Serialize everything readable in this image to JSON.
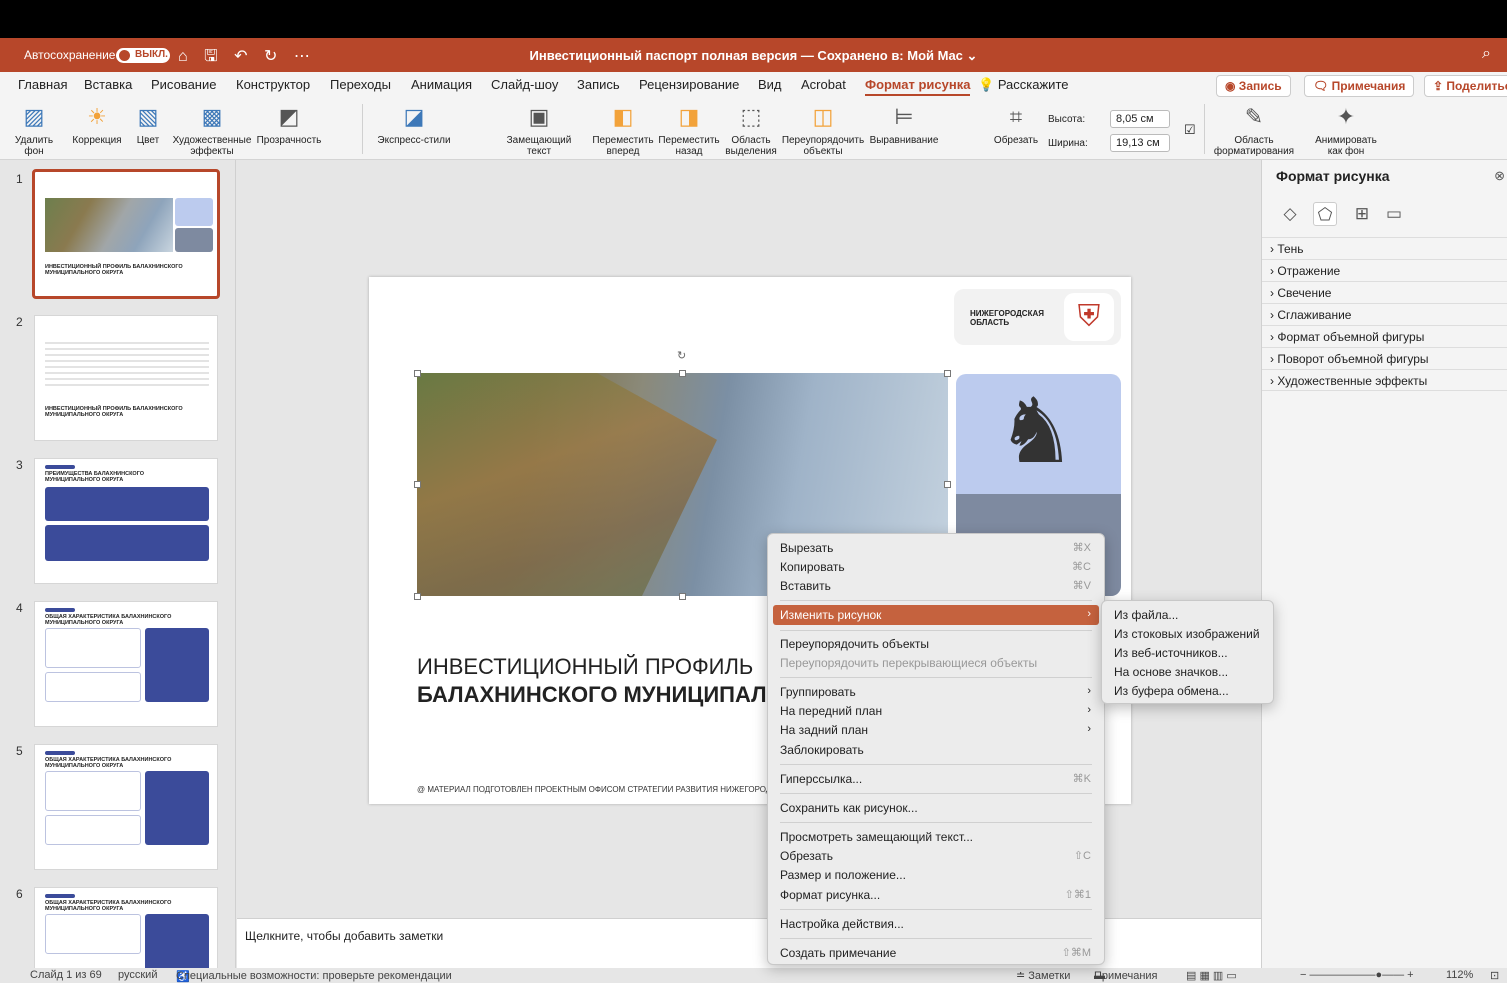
{
  "app": {
    "autosave_label": "Автосохранение",
    "autosave_state": "ВЫКЛ.",
    "doc_title": "Инвестиционный паспорт полная версия — Сохранено в: Мой Mac",
    "doc_title_caret": "⌄"
  },
  "tabs": [
    "Главная",
    "Вставка",
    "Рисование",
    "Конструктор",
    "Переходы",
    "Анимация",
    "Слайд-шоу",
    "Запись",
    "Рецензирование",
    "Вид",
    "Acrobat",
    "Формат рисунка",
    "Расскажите"
  ],
  "active_tab_index": 11,
  "header_buttons": {
    "record": "◉ Запись",
    "comments": "🗨 Примечания",
    "share": "⇪ Поделиться"
  },
  "ribbon": {
    "remove_bg": "Удалить фон",
    "correction": "Коррекция",
    "color": "Цвет",
    "artistic": "Художественные эффекты",
    "transparency": "Прозрачность",
    "quick_styles": "Экспресс-стили",
    "alt_text": "Замещающий текст",
    "bring_forward": "Переместить вперед",
    "send_backward": "Переместить назад",
    "selection_pane": "Область выделения",
    "reorder": "Переупорядочить объекты",
    "align": "Выравнивание",
    "crop": "Обрезать",
    "height_label": "Высота:",
    "height_value": "8,05 см",
    "width_label": "Ширина:",
    "width_value": "19,13 см",
    "format_pane": "Область форматирования",
    "animate_bg": "Анимировать как фон"
  },
  "thumbnails": [
    {
      "num": "1",
      "title": "ИНВЕСТИЦИОННЫЙ ПРОФИЛЬ БАЛАХНИНСКОГО МУНИЦИПАЛЬНОГО ОКРУГА"
    },
    {
      "num": "2",
      "title": "ИНВЕСТИЦИОННЫЙ ПРОФИЛЬ БАЛАХНИНСКОГО МУНИЦИПАЛЬНОГО ОКРУГА"
    },
    {
      "num": "3",
      "title": "ПРЕИМУЩЕСТВА БАЛАХНИНСКОГО МУНИЦИПАЛЬНОГО ОКРУГА"
    },
    {
      "num": "4",
      "title": "ОБЩАЯ ХАРАКТЕРИСТИКА БАЛАХНИНСКОГО МУНИЦИПАЛЬНОГО ОКРУГА"
    },
    {
      "num": "5",
      "title": "ОБЩАЯ ХАРАКТЕРИСТИКА БАЛАХНИНСКОГО МУНИЦИПАЛЬНОГО ОКРУГА"
    },
    {
      "num": "6",
      "title": "ОБЩАЯ ХАРАКТЕРИСТИКА БАЛАХНИНСКОГО МУНИЦИПАЛЬНОГО ОКРУГА"
    }
  ],
  "slide": {
    "region": "НИЖЕГОРОДСКАЯ ОБЛАСТЬ",
    "title_line1": "ИНВЕСТИЦИОННЫЙ ПРОФИЛЬ",
    "title_line2": "БАЛАХНИНСКОГО МУНИЦИПАЛЬНОГО ОКРУГА",
    "footer": "@ МАТЕРИАЛ ПОДГОТОВЛЕН ПРОЕКТНЫМ ОФИСОМ СТРАТЕГИИ РАЗВИТИЯ НИЖЕГОРОДСКОЙ ОБЛАСТИ"
  },
  "notes_placeholder": "Щелкните, чтобы добавить заметки",
  "format_pane": {
    "title": "Формат рисунка",
    "sections": [
      "Тень",
      "Отражение",
      "Свечение",
      "Сглаживание",
      "Формат объемной фигуры",
      "Поворот объемной фигуры",
      "Художественные эффекты"
    ]
  },
  "context_menu": [
    {
      "label": "Вырезать",
      "key": "⌘X"
    },
    {
      "label": "Копировать",
      "key": "⌘C"
    },
    {
      "label": "Вставить",
      "key": "⌘V"
    },
    {
      "label": "Изменить рисунок",
      "key": "›",
      "highlight": true
    },
    {
      "label": "Переупорядочить объекты",
      "key": ""
    },
    {
      "label": "Переупорядочить перекрывающиеся объекты",
      "key": "",
      "disabled": true
    },
    {
      "label": "Группировать",
      "key": "›"
    },
    {
      "label": "На передний план",
      "key": "›"
    },
    {
      "label": "На задний план",
      "key": "›"
    },
    {
      "label": "Заблокировать",
      "key": ""
    },
    {
      "label": "Гиперссылка...",
      "key": "⌘K"
    },
    {
      "label": "Сохранить как рисунок...",
      "key": ""
    },
    {
      "label": "Просмотреть замещающий текст...",
      "key": ""
    },
    {
      "label": "Обрезать",
      "key": "⇧C"
    },
    {
      "label": "Размер и положение...",
      "key": ""
    },
    {
      "label": "Формат рисунка...",
      "key": "⇧⌘1"
    },
    {
      "label": "Настройка действия...",
      "key": ""
    },
    {
      "label": "Создать примечание",
      "key": "⇧⌘M"
    }
  ],
  "submenu": [
    "Из файла...",
    "Из стоковых изображений",
    "Из веб-источников...",
    "На основе значков...",
    "Из буфера обмена..."
  ],
  "status": {
    "slide": "Слайд 1 из 69",
    "lang": "русский",
    "accessibility": "Специальные возможности: проверьте рекомендации",
    "notes": "≐ Заметки",
    "comments": "Примечания",
    "zoom": "112%"
  }
}
